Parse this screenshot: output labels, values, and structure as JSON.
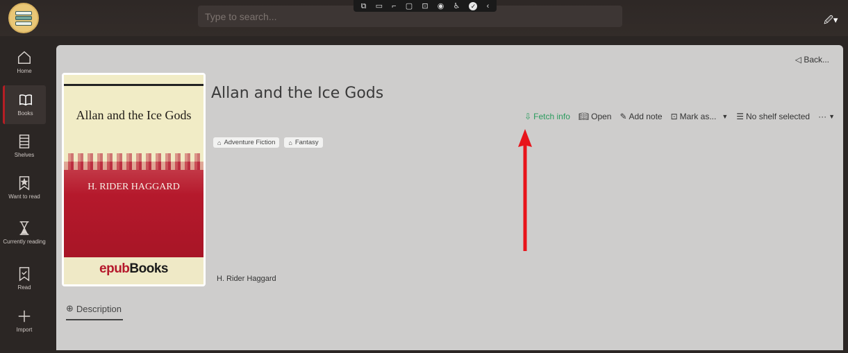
{
  "header": {
    "search_placeholder": "Type to search...",
    "pen_menu": "🖉▾"
  },
  "overlay_toolbar": {
    "icons": [
      "screen-add-icon",
      "video-icon",
      "pointer-icon",
      "window-icon",
      "screens-icon",
      "broadcast-icon",
      "accessibility-icon",
      "check-icon",
      "collapse-icon"
    ]
  },
  "sidebar": {
    "items": [
      {
        "label": "Home",
        "icon": "home-icon"
      },
      {
        "label": "Books",
        "icon": "book-icon",
        "active": true
      },
      {
        "label": "Shelves",
        "icon": "shelves-icon"
      },
      {
        "label": "Want to read",
        "icon": "bookmark-star-icon"
      },
      {
        "label": "Currently reading",
        "icon": "hourglass-icon"
      },
      {
        "label": "Read",
        "icon": "bookmark-check-icon"
      },
      {
        "label": "Import",
        "icon": "plus-icon"
      }
    ]
  },
  "book": {
    "back_label": "◁ Back...",
    "title": "Allan and the Ice Gods",
    "author": "H. Rider Haggard",
    "cover": {
      "title": "Allan and the Ice Gods",
      "author": "H. RIDER HAGGARD",
      "logo_epub": "epub",
      "logo_books": "Books"
    },
    "tags": [
      "Adventure Fiction",
      "Fantasy"
    ],
    "actions": {
      "fetch_info": "Fetch info",
      "open": "Open",
      "add_note": "Add note",
      "mark_as": "Mark as...",
      "shelf": "No shelf selected",
      "more": "···"
    },
    "tabs": {
      "description": "Description"
    }
  },
  "colors": {
    "accent_green": "#2a9b5d",
    "annotation_red": "#e8141b",
    "active_nav": "#b51e24"
  }
}
